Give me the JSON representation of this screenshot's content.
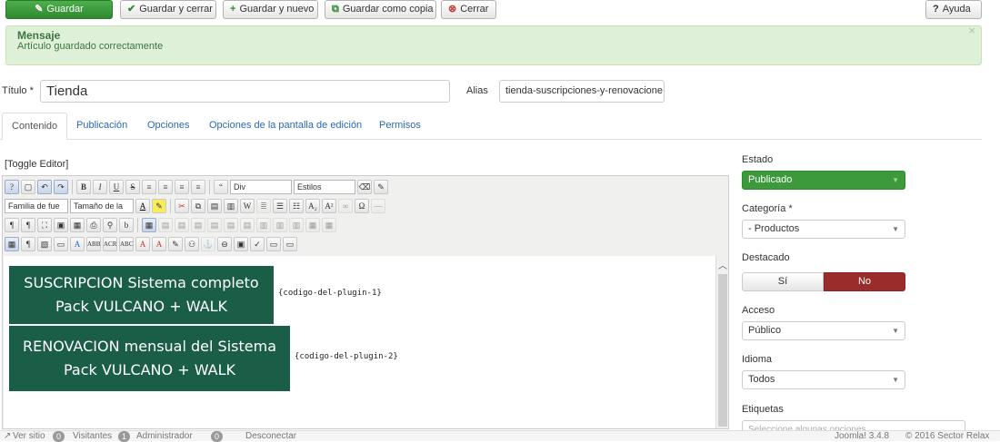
{
  "toolbar": {
    "save": "Guardar",
    "save_close": "Guardar y cerrar",
    "save_new": "Guardar y nuevo",
    "save_copy": "Guardar como copia",
    "close": "Cerrar",
    "help": "Ayuda"
  },
  "alert": {
    "title": "Mensaje",
    "message": "Artículo guardado correctamente",
    "close": "×"
  },
  "form": {
    "title_label": "Título *",
    "title_value": "Tienda",
    "alias_label": "Alias",
    "alias_value": "tienda-suscripciones-y-renovacione"
  },
  "tabs": [
    "Contenido",
    "Publicación",
    "Opciones",
    "Opciones de la pantalla de edición",
    "Permisos"
  ],
  "editor": {
    "toggle": "[Toggle Editor]",
    "format_select": "Div",
    "styles_select": "Estilos",
    "font_family_select": "Familia de fue",
    "font_size_select": "Tamaño de la",
    "content": {
      "banner1_line1": "SUSCRIPCION Sistema completo",
      "banner1_line2": "Pack VULCANO + WALK",
      "code1": "{codigo-del-plugin-1}",
      "banner2_line1": "RENOVACION mensual del Sistema",
      "banner2_line2": "Pack VULCANO + WALK",
      "code2": "{codigo-del-plugin-2}"
    }
  },
  "sidebar": {
    "estado_label": "Estado",
    "estado_value": "Publicado",
    "categoria_label": "Categoría *",
    "categoria_value": "- Productos",
    "destacado_label": "Destacado",
    "destacado_yes": "Sí",
    "destacado_no": "No",
    "acceso_label": "Acceso",
    "acceso_value": "Público",
    "idioma_label": "Idioma",
    "idioma_value": "Todos",
    "etiquetas_label": "Etiquetas",
    "etiquetas_placeholder": "Seleccione algunas opciones"
  },
  "statusbar": {
    "view_site": "Ver sitio",
    "visitors_count": "0",
    "visitors": "Visitantes",
    "admin_count": "1",
    "admin": "Administrador",
    "logout_count": "0",
    "logout": "Desconectar",
    "version": "Joomla! 3.4.8",
    "copyright": "© 2016 Sector Relax"
  },
  "colors": {
    "primary_green": "#3c9a3c",
    "banner": "#1b5e48",
    "no_red": "#9b2c2c",
    "link": "#2a69b8"
  }
}
